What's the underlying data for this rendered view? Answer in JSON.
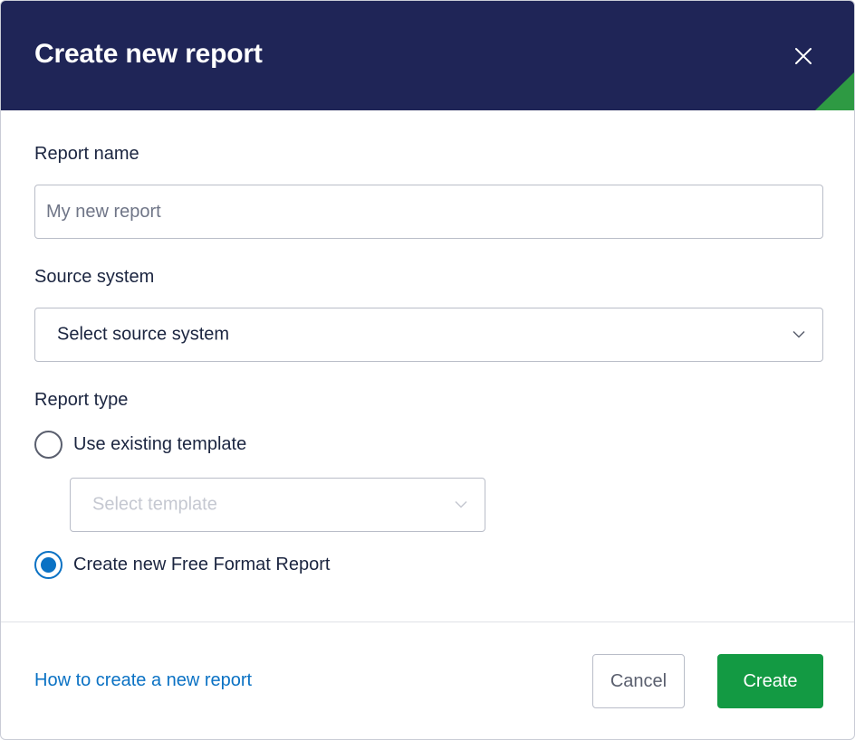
{
  "dialog": {
    "title": "Create new report",
    "close_icon": "close-icon",
    "accent_color": "#2e9a43",
    "header_color": "#1f2557"
  },
  "report_name": {
    "label": "Report name",
    "placeholder": "My new report",
    "value": ""
  },
  "source_system": {
    "label": "Source system",
    "selected": "Select source system",
    "icon": "chevron-down-icon"
  },
  "report_type": {
    "label": "Report type",
    "options": [
      {
        "label": "Use existing template",
        "checked": false
      },
      {
        "label": "Create new Free Format Report",
        "checked": true
      }
    ],
    "template_select": {
      "selected": "Select template",
      "disabled": true
    }
  },
  "footer": {
    "help_link": "How to create a new report",
    "cancel_label": "Cancel",
    "create_label": "Create",
    "create_color": "#139a43",
    "link_color": "#0b72c4"
  }
}
